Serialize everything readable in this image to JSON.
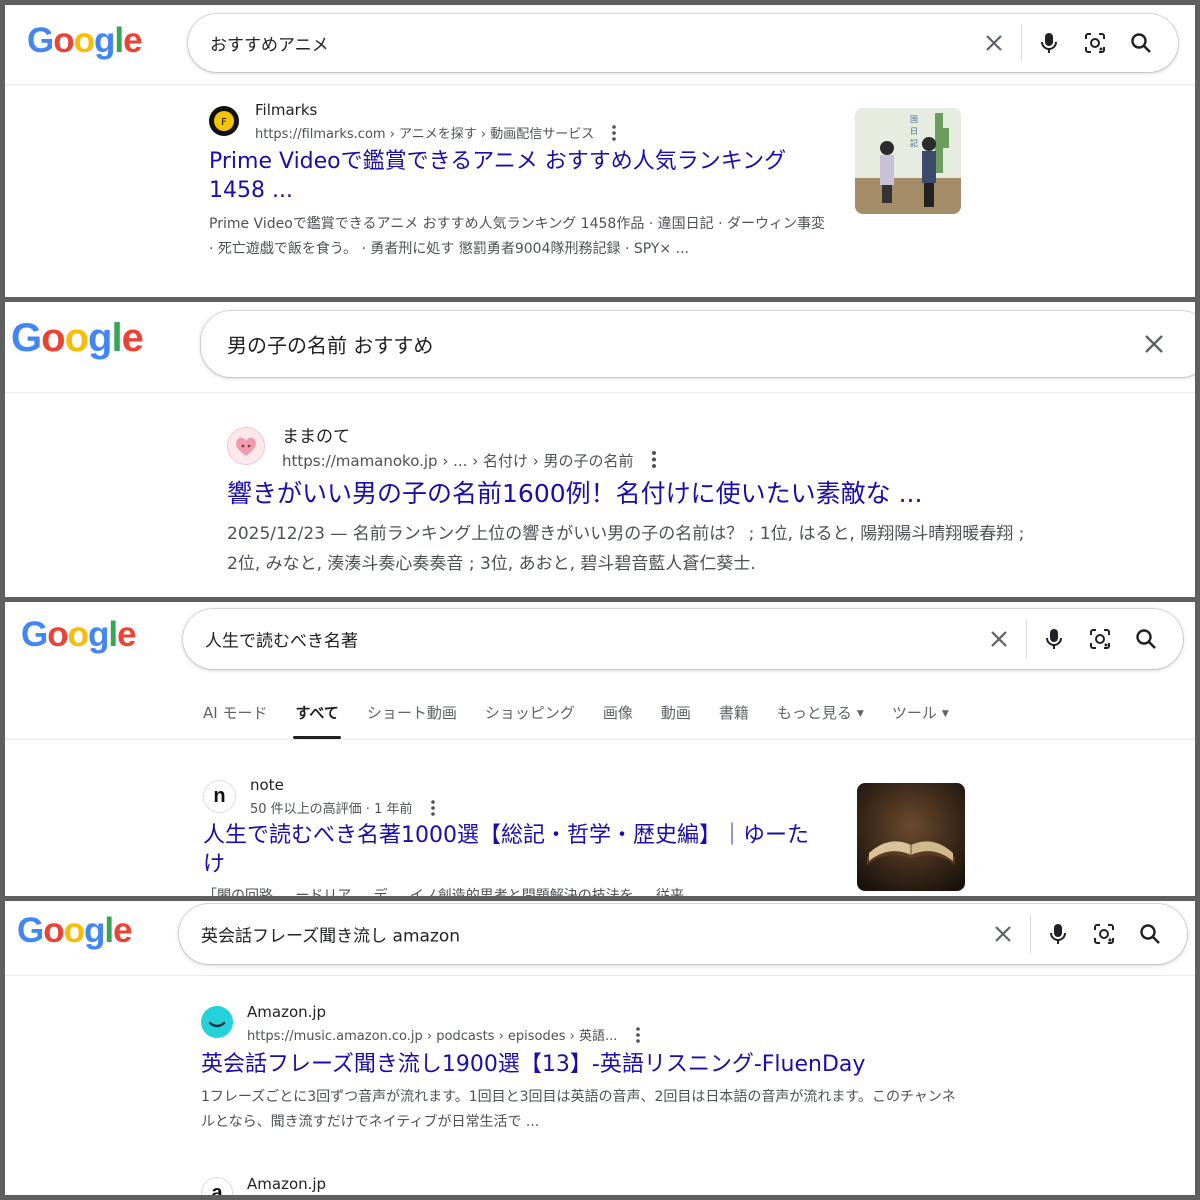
{
  "logo_letters": [
    "G",
    "o",
    "o",
    "g",
    "l",
    "e"
  ],
  "colors": {
    "g_blue": "#4285F4",
    "g_red": "#EA4335",
    "g_yellow": "#FBBC05",
    "g_green": "#34A853",
    "link": "#1a0dab"
  },
  "icons": {
    "clear": "close-icon",
    "voice": "microphone-icon",
    "lens": "camera-lens-icon",
    "search": "search-icon",
    "more": "kebab-icon"
  },
  "panel1": {
    "query": "おすすめアニメ",
    "result": {
      "site": "Filmarks",
      "url": "https://filmarks.com › アニメを探す › 動画配信サービス",
      "title": "Prime Videoで鑑賞できるアニメ おすすめ人気ランキング 1458 ...",
      "snippet": "Prime Videoで鑑賞できるアニメ おすすめ人気ランキング 1458作品 · 違国日記 · ダーウィン事変 · 死亡遊戯で飯を食う。 · 勇者刑に処す 懲罰勇者9004隊刑務記録 · SPY× ..."
    }
  },
  "panel2": {
    "query": "男の子の名前 おすすめ",
    "result": {
      "site": "ままのて",
      "url": "https://mamanoko.jp › ... › 名付け › 男の子の名前",
      "title": "響きがいい男の子の名前1600例！名付けに使いたい素敵な ...",
      "snippet_line1": "2025/12/23 — 名前ランキング上位の響きがいい男の子の名前は？ ; 1位, はると, 陽翔陽斗晴翔暖春翔 ;",
      "snippet_line2": "2位, みなと, 湊湊斗奏心奏奏音 ; 3位, あおと, 碧斗碧音藍人蒼仁葵士."
    }
  },
  "panel3": {
    "query": "人生で読むべき名著",
    "tabs": [
      "AI モード",
      "すべて",
      "ショート動画",
      "ショッピング",
      "画像",
      "動画",
      "書籍",
      "もっと見る",
      "ツール"
    ],
    "result": {
      "favicon_letter": "n",
      "site": "note",
      "url": "50 件以上の高評価 · 1 年前",
      "title": "人生で読むべき名著1000選【総記・哲学・歴史編】｜ゆーたけ",
      "snippet_cut": "「闇の回路 ... ードリア ... デ ... イノ創造的思考と問題解決の技法を ... 従来"
    }
  },
  "panel4": {
    "query": "英会話フレーズ聞き流し amazon",
    "result": {
      "site": "Amazon.jp",
      "url": "https://music.amazon.co.jp › podcasts › episodes › 英語...",
      "title": "英会話フレーズ聞き流し1900選【13】-英語リスニング-FluenDay",
      "snippet": "1フレーズごとに3回ずつ音声が流れます。1回目と3回目は英語の音声、2回目は日本語の音声が流れます。このチャンネルとなら、聞き流すだけでネイティブが日常生活で ..."
    },
    "next_site": "Amazon.jp",
    "next_favicon_letter": "a"
  }
}
